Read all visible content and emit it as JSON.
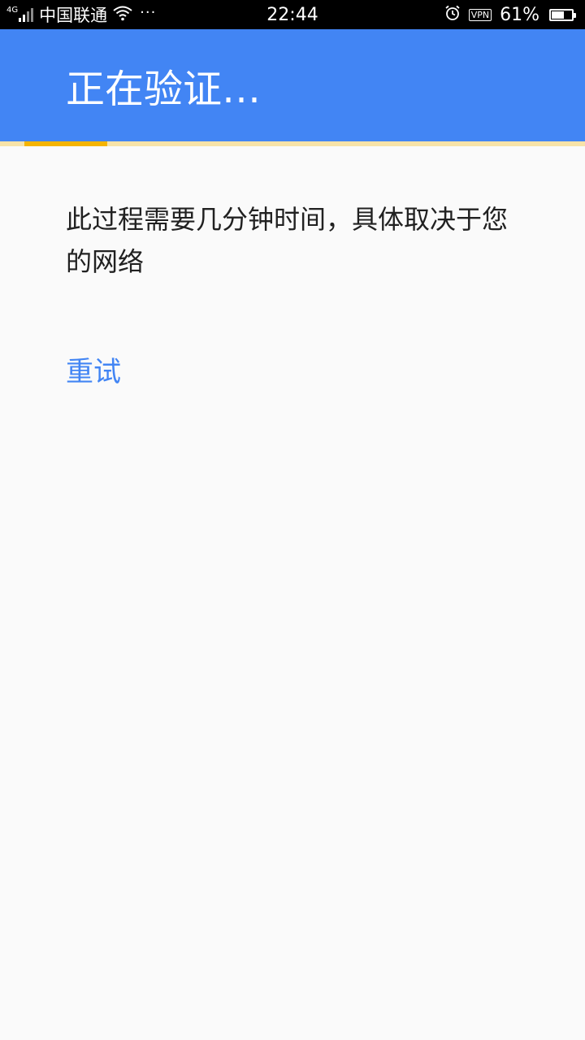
{
  "status_bar": {
    "network_type": "4G",
    "signal_level": 0.5,
    "carrier": "中国联通",
    "wifi_icon": "wifi-icon",
    "more_indicator": "···",
    "time": "22:44",
    "alarm_icon": "alarm-icon",
    "vpn_label": "VPN",
    "battery_percent": "61%",
    "battery_level": 0.61
  },
  "app_bar": {
    "title": "正在验证…",
    "color": "#4285f4"
  },
  "progress": {
    "track_color": "#f7e3a8",
    "indicator_color": "#f4b400"
  },
  "main": {
    "message": "此过程需要几分钟时间，具体取决于您的网络",
    "retry_label": "重试",
    "retry_color": "#4285f4"
  }
}
